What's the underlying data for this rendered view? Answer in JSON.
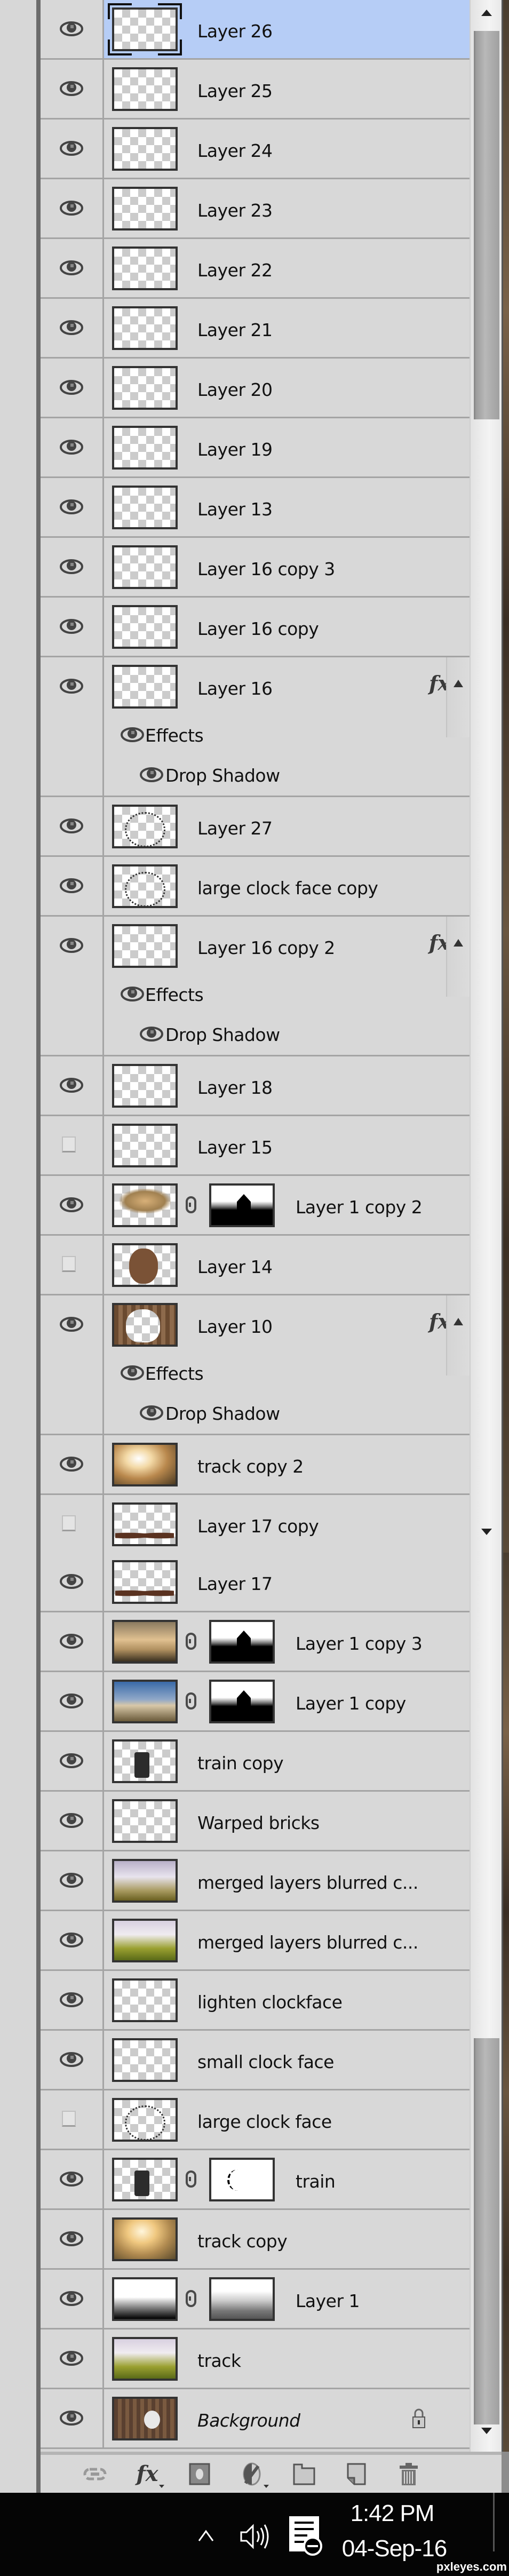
{
  "panel": {
    "section1": {
      "scroll_thumb": {
        "start_fraction": 0.02,
        "end_fraction": 0.27
      },
      "layers": [
        {
          "name": "Layer 26",
          "visible": true,
          "selected": true,
          "thumb": "transparent"
        },
        {
          "name": "Layer 25",
          "visible": true,
          "thumb": "transparent"
        },
        {
          "name": "Layer 24",
          "visible": true,
          "thumb": "transparent"
        },
        {
          "name": "Layer 23",
          "visible": true,
          "thumb": "transparent"
        },
        {
          "name": "Layer 22",
          "visible": true,
          "thumb": "transparent"
        },
        {
          "name": "Layer 21",
          "visible": true,
          "thumb": "transparent"
        },
        {
          "name": "Layer 20",
          "visible": true,
          "thumb": "transparent"
        },
        {
          "name": "Layer 19",
          "visible": true,
          "thumb": "transparent"
        },
        {
          "name": "Layer 13",
          "visible": true,
          "thumb": "transparent"
        },
        {
          "name": "Layer 16 copy 3",
          "visible": true,
          "thumb": "transparent"
        },
        {
          "name": "Layer 16 copy",
          "visible": true,
          "thumb": "transparent"
        },
        {
          "name": "Layer 16",
          "visible": true,
          "thumb": "transparent",
          "fx": true,
          "effects_label": "Effects",
          "effects": [
            "Drop Shadow"
          ]
        },
        {
          "name": "Layer 27",
          "visible": true,
          "thumb": "dots"
        },
        {
          "name": "large clock face copy",
          "visible": true,
          "thumb": "dots"
        },
        {
          "name": "Layer 16 copy 2",
          "visible": true,
          "thumb": "transparent",
          "fx": true,
          "effects_label": "Effects",
          "effects": [
            "Drop Shadow"
          ]
        },
        {
          "name": "Layer 18",
          "visible": true,
          "thumb": "transparent"
        },
        {
          "name": "Layer 15",
          "visible": false,
          "thumb": "transparent"
        },
        {
          "name": "Layer 1 copy 2",
          "visible": true,
          "thumb": "house-top",
          "mask": "house"
        },
        {
          "name": "Layer 14",
          "visible": false,
          "thumb": "blob"
        },
        {
          "name": "Layer 10",
          "visible": true,
          "thumb": "brickring",
          "fx": true,
          "effects_label": "Effects",
          "effects": [
            "Drop Shadow"
          ]
        },
        {
          "name": "track copy 2",
          "visible": true,
          "thumb": "track2"
        },
        {
          "name": "Layer 17 copy",
          "visible": false,
          "thumb": "shadows"
        }
      ]
    },
    "section2": {
      "scroll_thumb": {
        "start_fraction": 0.54,
        "end_fraction": 0.97
      },
      "layers": [
        {
          "name": "Layer 17",
          "visible": true,
          "thumb": "shadows"
        },
        {
          "name": "Layer 1 copy 3",
          "visible": true,
          "thumb": "house",
          "mask": "house"
        },
        {
          "name": "Layer 1 copy",
          "visible": true,
          "thumb": "blue",
          "mask": "house"
        },
        {
          "name": "train copy",
          "visible": true,
          "thumb": "train"
        },
        {
          "name": "Warped bricks",
          "visible": true,
          "thumb": "transparent"
        },
        {
          "name": "merged layers blurred c...",
          "visible": true,
          "thumb": "sky"
        },
        {
          "name": "merged layers blurred c...",
          "visible": true,
          "thumb": "grass"
        },
        {
          "name": "lighten clockface",
          "visible": true,
          "thumb": "transparent"
        },
        {
          "name": "small clock face",
          "visible": true,
          "thumb": "transparent"
        },
        {
          "name": "large clock face",
          "visible": false,
          "thumb": "dots"
        },
        {
          "name": "train",
          "visible": true,
          "thumb": "train",
          "mask": "train"
        },
        {
          "name": "track copy",
          "visible": true,
          "thumb": "track"
        },
        {
          "name": "Layer 1",
          "visible": true,
          "thumb": "grad",
          "mask": "grad"
        },
        {
          "name": "track",
          "visible": true,
          "thumb": "grass"
        },
        {
          "name": "Background",
          "visible": true,
          "thumb": "clock",
          "italic": true,
          "locked": true
        }
      ]
    },
    "toolbar": [
      {
        "icon": "link-layers-icon"
      },
      {
        "icon": "add-layer-style-icon",
        "label": "fx",
        "has_menu": true
      },
      {
        "icon": "add-mask-icon"
      },
      {
        "icon": "adjustment-layer-icon",
        "has_menu": true
      },
      {
        "icon": "new-group-icon"
      },
      {
        "icon": "new-layer-icon"
      },
      {
        "icon": "delete-layer-icon"
      }
    ]
  },
  "taskbar": {
    "time": "1:42 PM",
    "date": "04-Sep-16",
    "tray_icons": [
      "show-hidden-icons-chevron",
      "volume-icon",
      "notifications-icon"
    ]
  },
  "watermark": "pxleyes.com",
  "colors": {
    "selected_row": "#b6cdf6",
    "panel_bg": "#d8d8d8",
    "taskbar_bg": "#050505"
  }
}
